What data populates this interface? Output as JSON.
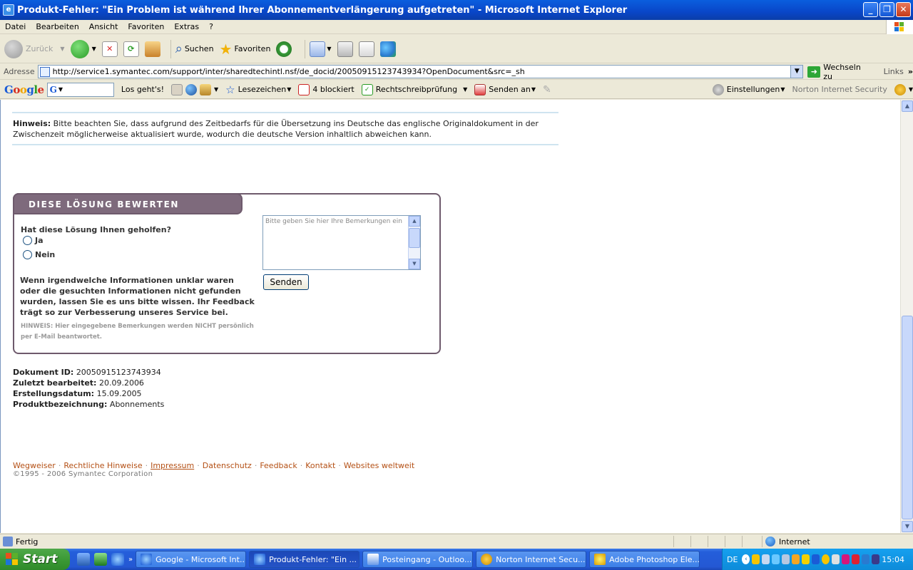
{
  "window": {
    "title": "Produkt-Fehler: \"Ein Problem ist während Ihrer Abonnementverlängerung aufgetreten\" - Microsoft Internet Explorer"
  },
  "menu": [
    "Datei",
    "Bearbeiten",
    "Ansicht",
    "Favoriten",
    "Extras",
    "?"
  ],
  "toolbar": {
    "back": "Zurück",
    "search": "Suchen",
    "favorites": "Favoriten"
  },
  "address": {
    "label": "Adresse",
    "url": "http://service1.symantec.com/support/inter/sharedtechintl.nsf/de_docid/20050915123743934?OpenDocument&src=_sh",
    "go": "Wechseln zu",
    "links": "Links"
  },
  "googlebar": {
    "logo": "Google",
    "search_icon_letter": "G",
    "go": "Los geht's!",
    "bookmarks": "Lesezeichen",
    "blocked": "4 blockiert",
    "spell": "Rechtschreibprüfung",
    "send": "Senden an",
    "settings": "Einstellungen",
    "norton": "Norton Internet Security"
  },
  "page": {
    "notice_label": "Hinweis:",
    "notice_text": " Bitte beachten Sie, dass aufgrund des Zeitbedarfs für die Übersetzung ins Deutsche das englische Originaldokument in der Zwischenzeit möglicherweise aktualisiert wurde, wodurch die deutsche Version inhaltlich abweichen kann.",
    "rating": {
      "heading": "DIESE LÖSUNG BEWERTEN",
      "question": "Hat diese Lösung Ihnen geholfen?",
      "yes": "Ja",
      "no": "Nein",
      "info": "Wenn irgendwelche Informationen unklar waren oder die gesuchten Informationen nicht gefunden wurden, lassen Sie es uns bitte wissen. Ihr Feedback trägt so zur Verbesserung unseres Service bei.",
      "hint": "HINWEIS: Hier eingegebene Bemerkungen werden NICHT persönlich per E-Mail beantwortet.",
      "textarea_placeholder": "Bitte geben Sie hier Ihre Bemerkungen ein",
      "submit": "Senden"
    },
    "meta": {
      "doc_id_label": "Dokument ID:",
      "doc_id": "20050915123743934",
      "updated_label": "Zuletzt bearbeitet:",
      "updated": "20.09.2006",
      "created_label": "Erstellungsdatum:",
      "created": "15.09.2005",
      "product_label": "Produktbezeichnung:",
      "product": "Abonnements"
    },
    "footer": {
      "links": [
        "Wegweiser",
        "Rechtliche Hinweise",
        "Impressum",
        "Datenschutz",
        "Feedback",
        "Kontakt",
        "Websites weltweit"
      ],
      "copyright": "©1995 - 2006 Symantec Corporation"
    }
  },
  "status": {
    "text": "Fertig",
    "zone": "Internet"
  },
  "taskbar": {
    "start": "Start",
    "tasks": [
      "Google - Microsoft Int...",
      "Produkt-Fehler: \"Ein ...",
      "Posteingang - Outloo...",
      "Norton Internet Secu...",
      "Adobe Photoshop Ele..."
    ],
    "lang": "DE",
    "clock": "15:04"
  },
  "colors": {
    "accent_box": "#7e6a7c",
    "link": "#b45015",
    "titlebar": "#0a46c8"
  }
}
